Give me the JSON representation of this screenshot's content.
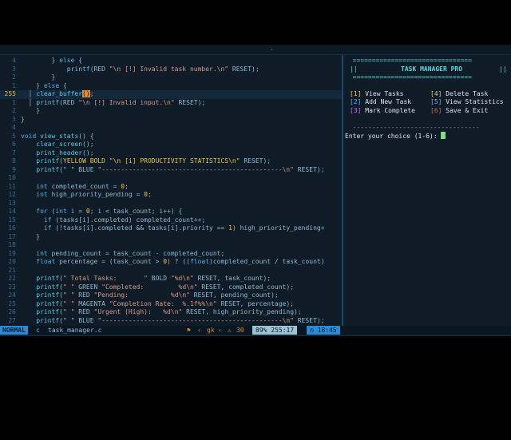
{
  "topbar": {
    "indicator": "-"
  },
  "editor": {
    "lines": [
      {
        "n": "4",
        "segs": [
          [
            "        } ",
            "c"
          ],
          [
            "else",
            "kw"
          ],
          [
            " {",
            "c"
          ]
        ]
      },
      {
        "n": "3",
        "segs": [
          [
            "            ",
            "c"
          ],
          [
            "printf",
            "fn"
          ],
          [
            "(RED ",
            "c"
          ],
          [
            "\"\\n [!] Invalid task number.\\n\"",
            "str"
          ],
          [
            " RESET);",
            "c"
          ]
        ]
      },
      {
        "n": "2",
        "segs": [
          [
            "        }",
            "c"
          ]
        ]
      },
      {
        "n": "1",
        "segs": [
          [
            "    } ",
            "c"
          ],
          [
            "else",
            "kw"
          ],
          [
            " {",
            "c"
          ]
        ]
      },
      {
        "n": "255",
        "cur": true,
        "segs": [
          [
            "  │ ",
            "c"
          ],
          [
            "clear_buffer",
            "fn"
          ],
          [
            "()",
            "cb"
          ],
          [
            ";",
            "c"
          ]
        ]
      },
      {
        "n": "1",
        "segs": [
          [
            "  │ ",
            "c"
          ],
          [
            "printf",
            "fn"
          ],
          [
            "(RED ",
            "c"
          ],
          [
            "\"\\n [!] Invalid input.\\n\"",
            "str"
          ],
          [
            " RESET);",
            "c"
          ]
        ]
      },
      {
        "n": "2",
        "segs": [
          [
            "    }",
            "c"
          ]
        ]
      },
      {
        "n": "3",
        "segs": [
          [
            "}",
            "c"
          ]
        ]
      },
      {
        "n": "4",
        "segs": [
          [
            "",
            "c"
          ]
        ]
      },
      {
        "n": "5",
        "segs": [
          [
            "void ",
            "kw"
          ],
          [
            "view_stats",
            "fn"
          ],
          [
            "() {",
            "c"
          ]
        ]
      },
      {
        "n": "6",
        "segs": [
          [
            "    ",
            "c"
          ],
          [
            "clear_screen",
            "fn"
          ],
          [
            "();",
            "c"
          ]
        ]
      },
      {
        "n": "7",
        "segs": [
          [
            "    ",
            "c"
          ],
          [
            "print_header",
            "fn"
          ],
          [
            "();",
            "c"
          ]
        ]
      },
      {
        "n": "8",
        "segs": [
          [
            "    ",
            "c"
          ],
          [
            "printf",
            "fn"
          ],
          [
            "(",
            "c"
          ],
          [
            "YELLOW BOLD \"\\n [i] PRODUCTIVITY STATISTICS\\n\"",
            "col"
          ],
          [
            " RESET);",
            "c"
          ]
        ]
      },
      {
        "n": "9",
        "segs": [
          [
            "    ",
            "c"
          ],
          [
            "printf",
            "fn"
          ],
          [
            "(\" \" BLUE ",
            "c"
          ],
          [
            "\"-----------------------------------------------\\n\"",
            "str"
          ],
          [
            " RESET);",
            "c"
          ]
        ]
      },
      {
        "n": "10",
        "segs": [
          [
            "",
            "c"
          ]
        ]
      },
      {
        "n": "11",
        "segs": [
          [
            "    ",
            "c"
          ],
          [
            "int ",
            "kw"
          ],
          [
            "completed_count = ",
            "c"
          ],
          [
            "0",
            "col"
          ],
          [
            ";",
            "c"
          ]
        ]
      },
      {
        "n": "12",
        "segs": [
          [
            "    ",
            "c"
          ],
          [
            "int ",
            "kw"
          ],
          [
            "high_priority_pending = ",
            "c"
          ],
          [
            "0",
            "col"
          ],
          [
            ";",
            "c"
          ]
        ]
      },
      {
        "n": "13",
        "segs": [
          [
            "",
            "c"
          ]
        ]
      },
      {
        "n": "14",
        "segs": [
          [
            "    ",
            "c"
          ],
          [
            "for ",
            "kw"
          ],
          [
            "(",
            "c"
          ],
          [
            "int ",
            "kw"
          ],
          [
            "i = ",
            "c"
          ],
          [
            "0",
            "col"
          ],
          [
            "; i < task_count; i++) {",
            "c"
          ]
        ]
      },
      {
        "n": "15",
        "segs": [
          [
            "      ",
            "c"
          ],
          [
            "if ",
            "kw"
          ],
          [
            "(tasks[i].completed) completed_count++;",
            "c"
          ]
        ]
      },
      {
        "n": "16",
        "segs": [
          [
            "      ",
            "c"
          ],
          [
            "if ",
            "kw"
          ],
          [
            "(!tasks[i].completed && tasks[i].priority == ",
            "c"
          ],
          [
            "1",
            "col"
          ],
          [
            ") high_priority_pending+",
            "c"
          ]
        ]
      },
      {
        "n": "17",
        "segs": [
          [
            "    }",
            "c"
          ]
        ]
      },
      {
        "n": "18",
        "segs": [
          [
            "",
            "c"
          ]
        ]
      },
      {
        "n": "19",
        "segs": [
          [
            "    ",
            "c"
          ],
          [
            "int ",
            "kw"
          ],
          [
            "pending_count = task_count - completed_count;",
            "c"
          ]
        ]
      },
      {
        "n": "20",
        "segs": [
          [
            "    ",
            "c"
          ],
          [
            "float ",
            "kw"
          ],
          [
            "percentage = (task_count > ",
            "c"
          ],
          [
            "0",
            "col"
          ],
          [
            ") ? ((",
            "c"
          ],
          [
            "float",
            "kw"
          ],
          [
            ")completed_count / task_count)",
            "c"
          ]
        ]
      },
      {
        "n": "21",
        "segs": [
          [
            "",
            "c"
          ]
        ]
      },
      {
        "n": "22",
        "segs": [
          [
            "    ",
            "c"
          ],
          [
            "printf",
            "fn"
          ],
          [
            "(",
            "c"
          ],
          [
            "\" Total Tasks:       \"",
            "str"
          ],
          [
            " BOLD ",
            "c"
          ],
          [
            "\"%d\\n\"",
            "str"
          ],
          [
            " RESET, task_count);",
            "c"
          ]
        ]
      },
      {
        "n": "23",
        "segs": [
          [
            "    ",
            "c"
          ],
          [
            "printf",
            "fn"
          ],
          [
            "(",
            "c"
          ],
          [
            "\" \"",
            "str"
          ],
          [
            " GREEN ",
            "c"
          ],
          [
            "\"Completed:         %d\\n\"",
            "str"
          ],
          [
            " RESET, completed_count);",
            "c"
          ]
        ]
      },
      {
        "n": "24",
        "segs": [
          [
            "    ",
            "c"
          ],
          [
            "printf",
            "fn"
          ],
          [
            "(",
            "c"
          ],
          [
            "\" \"",
            "str"
          ],
          [
            " RED ",
            "c"
          ],
          [
            "\"Pending:           %d\\n\"",
            "str"
          ],
          [
            " RESET, pending_count);",
            "c"
          ]
        ]
      },
      {
        "n": "25",
        "segs": [
          [
            "    ",
            "c"
          ],
          [
            "printf",
            "fn"
          ],
          [
            "(",
            "c"
          ],
          [
            "\" \"",
            "str"
          ],
          [
            " MAGENTA ",
            "c"
          ],
          [
            "\"Completion Rate:  %.1f%%\\n\"",
            "str"
          ],
          [
            " RESET, percentage);",
            "c"
          ]
        ]
      },
      {
        "n": "26",
        "segs": [
          [
            "    ",
            "c"
          ],
          [
            "printf",
            "fn"
          ],
          [
            "(",
            "c"
          ],
          [
            "\" \"",
            "str"
          ],
          [
            " RED ",
            "c"
          ],
          [
            "\"Urgent (High):   %d\\n\"",
            "str"
          ],
          [
            " RESET, high_priority_pending);",
            "c"
          ]
        ]
      },
      {
        "n": "27",
        "segs": [
          [
            "    ",
            "c"
          ],
          [
            "printf",
            "fn"
          ],
          [
            "(\" \" BLUE ",
            "c"
          ],
          [
            "\"-----------------------------------------------\\n\"",
            "str"
          ],
          [
            " RESET);",
            "c"
          ]
        ]
      }
    ]
  },
  "terminal": {
    "border_top": "  ===============================",
    "title_left": "||",
    "title": "TASK MANAGER PRO",
    "title_right": "||",
    "border_bottom": "  ===============================",
    "menu": [
      {
        "key": "[1]",
        "label": "View Tasks",
        "color": "tyel"
      },
      {
        "key": "[2]",
        "label": "Add New Task",
        "color": "tblue"
      },
      {
        "key": "[3]",
        "label": "Mark Complete",
        "color": "tmag"
      },
      {
        "key": "[4]",
        "label": "Delete Task",
        "color": "tyel"
      },
      {
        "key": "[5]",
        "label": "View Statistics",
        "color": "tblue"
      },
      {
        "key": "[6]",
        "label": "Save & Exit",
        "color": "tred"
      }
    ],
    "separator": "  ---------------------------------",
    "prompt": "Enter your choice (1-6): "
  },
  "statusbar": {
    "mode": "NORMAL",
    "filetype": "c",
    "filename": "task_manager.c",
    "branch": "gk",
    "count": "30",
    "position": "89% 255:17",
    "time": "18:45"
  }
}
